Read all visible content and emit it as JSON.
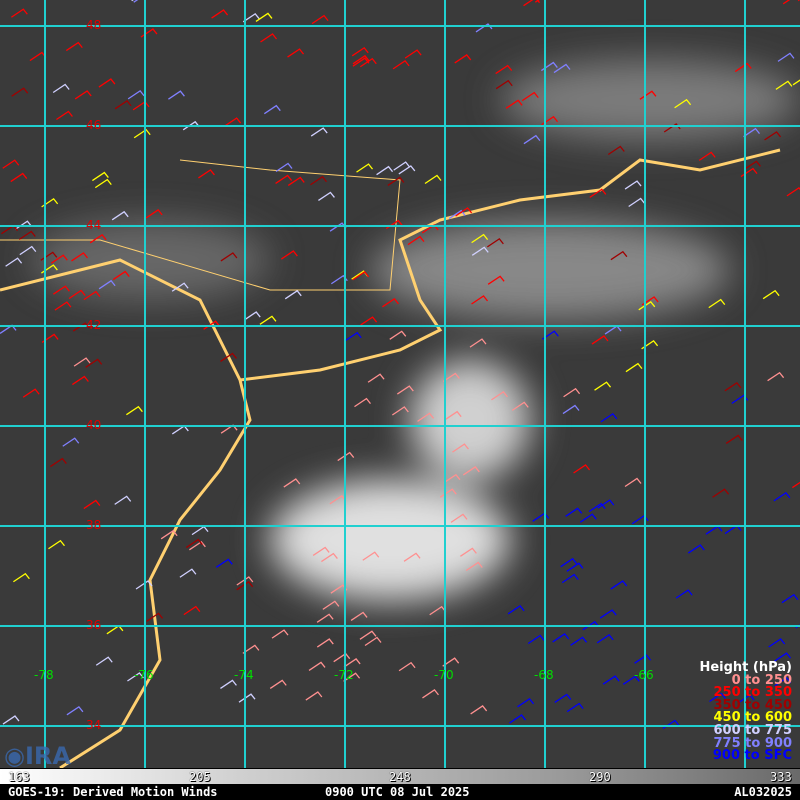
{
  "map": {
    "lat_labels": [
      "48",
      "46",
      "44",
      "42",
      "40",
      "38",
      "36",
      "34"
    ],
    "lon_labels": [
      "-78",
      "-76",
      "-74",
      "-72",
      "-70",
      "-68",
      "-66"
    ]
  },
  "legend": {
    "title": "Height (hPa)",
    "items": [
      {
        "label": "0 to 250",
        "color": "#ff9090"
      },
      {
        "label": "250 to 350",
        "color": "#ff0000"
      },
      {
        "label": "350 to 450",
        "color": "#a00000"
      },
      {
        "label": "450 to 600",
        "color": "#ffff00"
      },
      {
        "label": "600 to 775",
        "color": "#d0d0ff"
      },
      {
        "label": "775 to 900",
        "color": "#8080ff"
      },
      {
        "label": "900 to SFC",
        "color": "#0000ff"
      }
    ]
  },
  "colorbar": {
    "ticks": [
      "163",
      "205",
      "248",
      "290",
      "333"
    ]
  },
  "footer": {
    "left": "GOES-19: Derived Motion Winds",
    "center": "0900 UTC 08 Jul 2025",
    "right": "AL032025"
  },
  "logo": {
    "text": "CIRA"
  }
}
